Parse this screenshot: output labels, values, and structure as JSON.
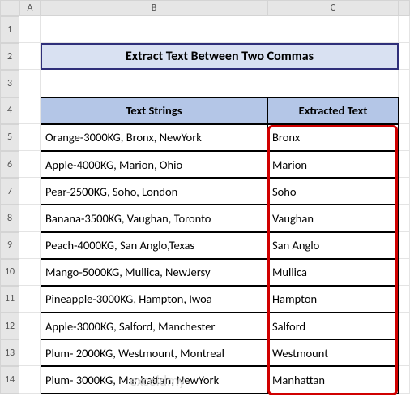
{
  "columns": [
    "A",
    "B",
    "C"
  ],
  "rows": [
    "1",
    "2",
    "3",
    "4",
    "5",
    "6",
    "7",
    "8",
    "9",
    "10",
    "11",
    "12",
    "13",
    "14"
  ],
  "title": "Extract Text Between Two Commas",
  "headers": {
    "col_b": "Text Strings",
    "col_c": "Extracted Text"
  },
  "data": [
    {
      "b": "Orange-3000KG, Bronx, NewYork",
      "c": "Bronx"
    },
    {
      "b": "Apple-4000KG, Marion, Ohio",
      "c": "Marion"
    },
    {
      "b": "Pear-2500KG, Soho, London",
      "c": "Soho"
    },
    {
      "b": "Banana-3500KG, Vaughan, Toronto",
      "c": "Vaughan"
    },
    {
      "b": "Peach-4000KG, San Anglo,Texas",
      "c": "San Anglo"
    },
    {
      "b": "Mango-5000KG, Mullica, NewJersy",
      "c": "Mullica"
    },
    {
      "b": "Pineapple-3000KG, Hampton, Iwoa",
      "c": "Hampton"
    },
    {
      "b": "Apple-3000KG, Salford, Manchester",
      "c": "Salford"
    },
    {
      "b": "Plum- 2000KG, Westmount, Montreal",
      "c": "Westmount"
    },
    {
      "b": "Plum- 3000KG, Manhattan, NewYork",
      "c": "Manhattan"
    }
  ],
  "watermark": "exceldmy",
  "chart_data": {
    "type": "table",
    "title": "Extract Text Between Two Commas",
    "columns": [
      "Text Strings",
      "Extracted Text"
    ],
    "rows": [
      [
        "Orange-3000KG, Bronx, NewYork",
        "Bronx"
      ],
      [
        "Apple-4000KG, Marion, Ohio",
        "Marion"
      ],
      [
        "Pear-2500KG, Soho, London",
        "Soho"
      ],
      [
        "Banana-3500KG, Vaughan, Toronto",
        "Vaughan"
      ],
      [
        "Peach-4000KG, San Anglo,Texas",
        "San Anglo"
      ],
      [
        "Mango-5000KG, Mullica, NewJersy",
        "Mullica"
      ],
      [
        "Pineapple-3000KG, Hampton, Iwoa",
        "Hampton"
      ],
      [
        "Apple-3000KG, Salford, Manchester",
        "Salford"
      ],
      [
        "Plum- 2000KG, Westmount, Montreal",
        "Westmount"
      ],
      [
        "Plum- 3000KG, Manhattan, NewYork",
        "Manhattan"
      ]
    ]
  }
}
